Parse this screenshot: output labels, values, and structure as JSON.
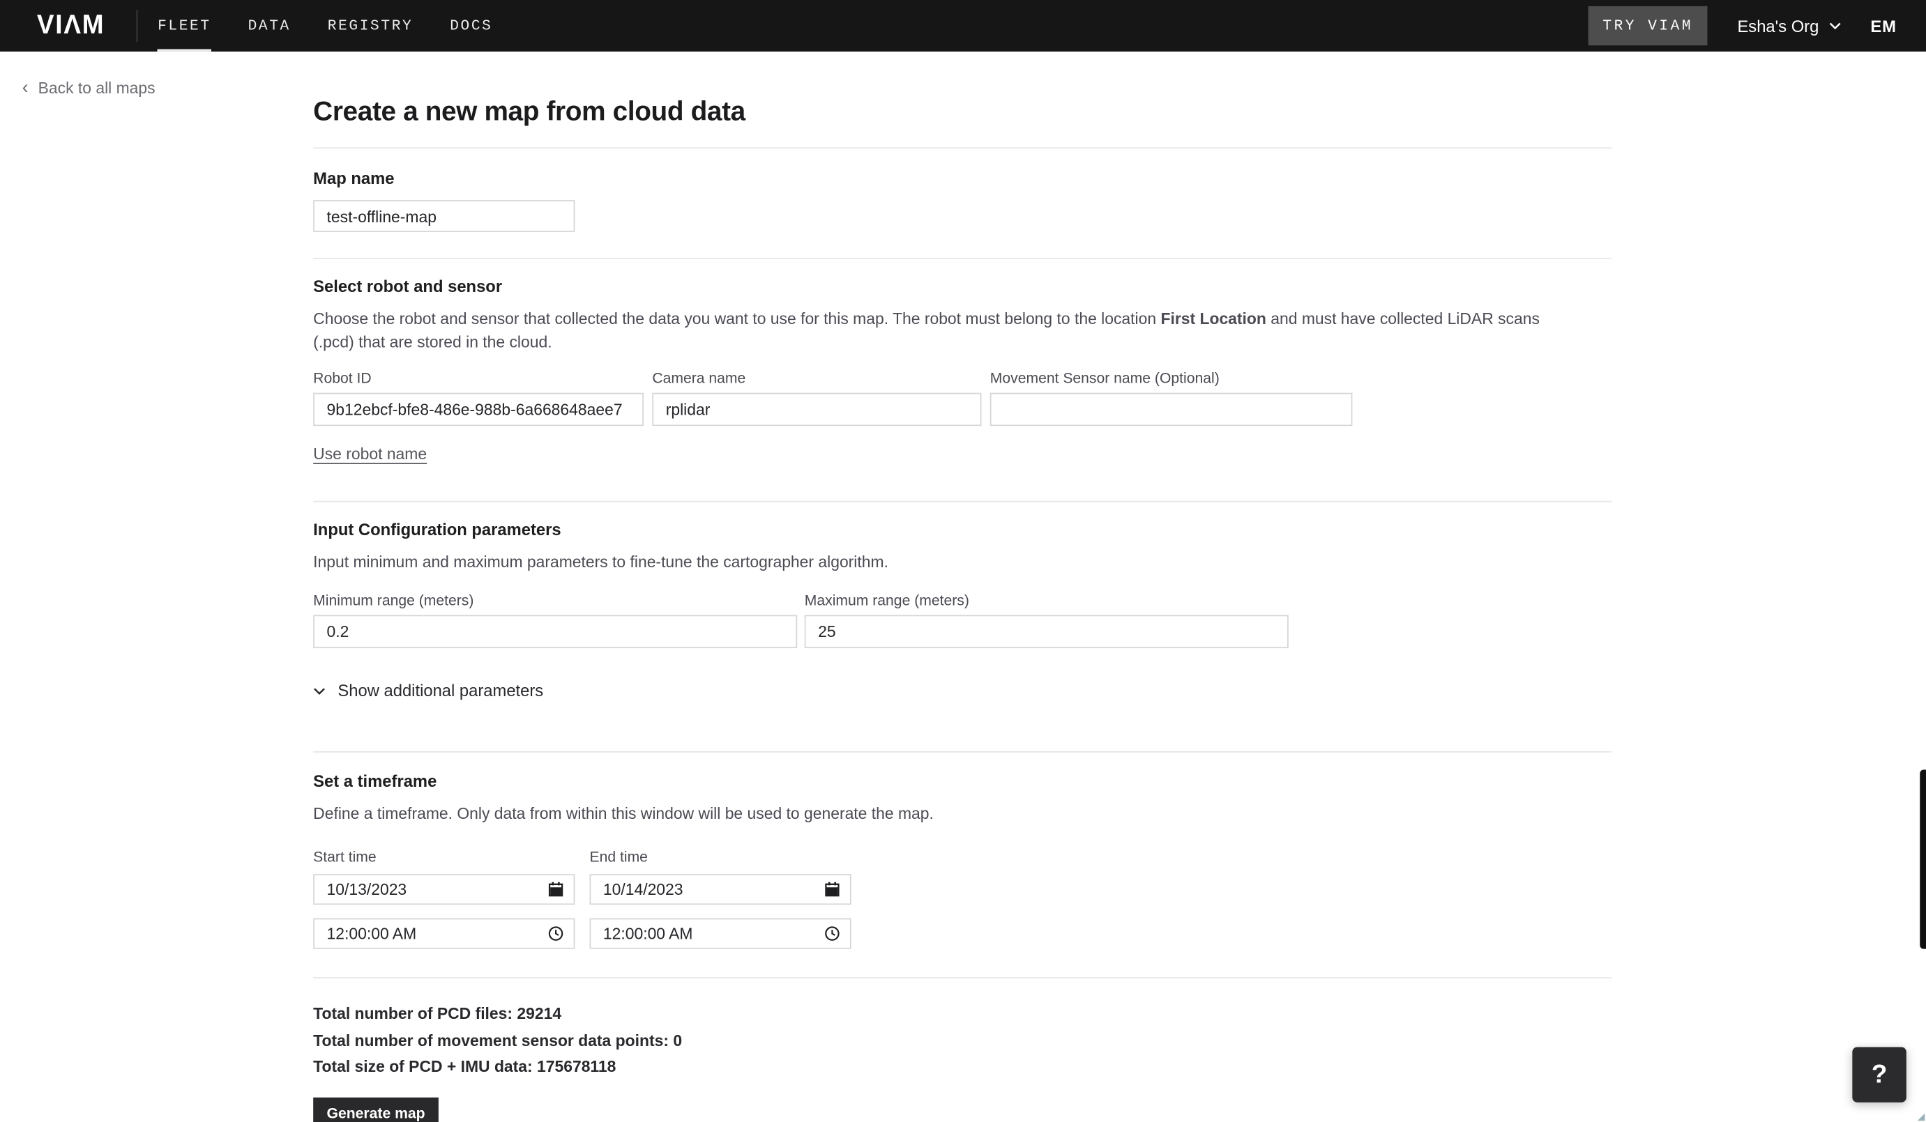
{
  "nav": {
    "logo": "VIΛM",
    "items": [
      {
        "label": "FLEET"
      },
      {
        "label": "DATA"
      },
      {
        "label": "REGISTRY"
      },
      {
        "label": "DOCS"
      }
    ],
    "try_viam_label": "TRY VIAM",
    "org_name": "Esha's Org",
    "user_initials": "EM"
  },
  "breadcrumb": {
    "chevron": "‹",
    "back_label": "Back to all maps"
  },
  "page": {
    "title": "Create a new map from cloud data"
  },
  "map_name": {
    "label": "Map name",
    "value": "test-offline-map"
  },
  "robot_section": {
    "heading": "Select robot and sensor",
    "description_before": "Choose the robot and sensor that collected the data you want to use for this map. The robot must belong to the location ",
    "description_bold": "First Location",
    "description_after": " and must have collected LiDAR scans (.pcd) that are stored in the cloud.",
    "robot_id": {
      "label": "Robot ID",
      "value": "9b12ebcf-bfe8-486e-988b-6a668648aee7"
    },
    "camera": {
      "label": "Camera name",
      "value": "rplidar"
    },
    "movement_sensor": {
      "label": "Movement Sensor name (Optional)",
      "value": ""
    },
    "use_robot_name_label": "Use robot name"
  },
  "config_section": {
    "heading": "Input Configuration parameters",
    "description": "Input minimum and maximum parameters to fine-tune the cartographer algorithm.",
    "min_range": {
      "label": "Minimum range (meters)",
      "value": "0.2"
    },
    "max_range": {
      "label": "Maximum range (meters)",
      "value": "25"
    },
    "show_additional_label": "Show additional parameters"
  },
  "timeframe_section": {
    "heading": "Set a timeframe",
    "description": "Define a timeframe. Only data from within this window will be used to generate the map.",
    "start": {
      "label": "Start time",
      "date": "10/13/2023",
      "time": "12:00:00 AM"
    },
    "end": {
      "label": "End time",
      "date": "10/14/2023",
      "time": "12:00:00 AM"
    }
  },
  "summary": {
    "pcd_files": "Total number of PCD files: 29214",
    "movement_points": "Total number of movement sensor data points: 0",
    "total_size": "Total size of PCD + IMU data: 175678118"
  },
  "actions": {
    "generate_label": "Generate map",
    "help_label": "?"
  },
  "colors": {
    "nav_background": "#161616",
    "try_viam_background": "#4d4d4d",
    "generate_button_background": "#29292b",
    "input_border": "#d6d6d8",
    "divider": "#e6e6e8",
    "body_text": "#4b4b54"
  }
}
